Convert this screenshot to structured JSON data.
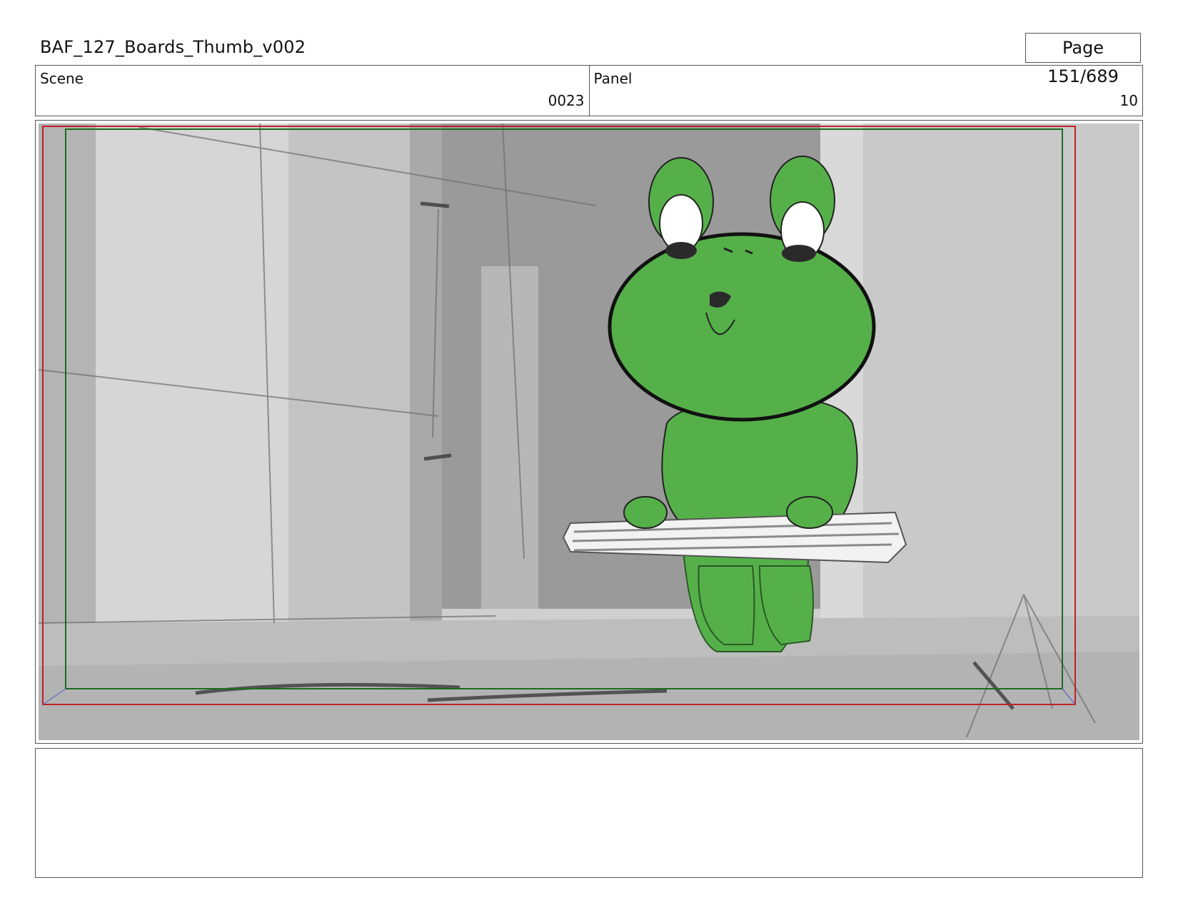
{
  "header": {
    "title": "BAF_127_Boards_Thumb_v002",
    "page": "Page 151/689"
  },
  "info": {
    "scene_label": "Scene",
    "scene_value": "0023",
    "panel_label": "Panel",
    "panel_value": "10"
  },
  "colors": {
    "safe_frame_red": "#c0202a",
    "action_frame_green": "#1e6b1e",
    "frog_green": "#56b04a"
  },
  "panel": {
    "notes": ""
  }
}
